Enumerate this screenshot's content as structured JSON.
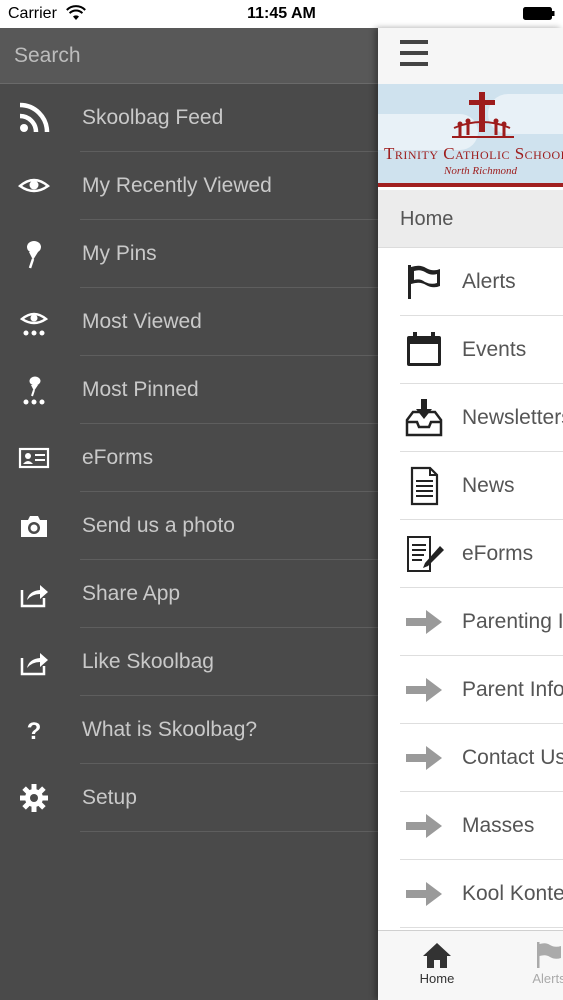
{
  "status_bar": {
    "carrier": "Carrier",
    "time": "11:45 AM"
  },
  "side_menu": {
    "search_placeholder": "Search",
    "items": [
      {
        "label": "Skoolbag Feed",
        "icon": "rss-icon"
      },
      {
        "label": "My Recently Viewed",
        "icon": "eye-icon"
      },
      {
        "label": "My Pins",
        "icon": "pin-icon"
      },
      {
        "label": "Most Viewed",
        "icon": "most-viewed-icon"
      },
      {
        "label": "Most Pinned",
        "icon": "most-pinned-icon"
      },
      {
        "label": "eForms",
        "icon": "id-card-icon"
      },
      {
        "label": "Send us a photo",
        "icon": "camera-icon"
      },
      {
        "label": "Share App",
        "icon": "share-icon"
      },
      {
        "label": "Like Skoolbag",
        "icon": "share-icon"
      },
      {
        "label": "What is Skoolbag?",
        "icon": "question-icon"
      },
      {
        "label": "Setup",
        "icon": "gear-icon"
      }
    ]
  },
  "main": {
    "banner": {
      "school_name": "Trinity Catholic School",
      "school_sub": "North Richmond"
    },
    "section_title": "Home",
    "items": [
      {
        "label": "Alerts",
        "icon": "flag-icon"
      },
      {
        "label": "Events",
        "icon": "calendar-icon"
      },
      {
        "label": "Newsletters",
        "icon": "inbox-download-icon"
      },
      {
        "label": "News",
        "icon": "document-icon"
      },
      {
        "label": "eForms",
        "icon": "form-pen-icon"
      },
      {
        "label": "Parenting Ideas",
        "icon": "arrow-right-icon"
      },
      {
        "label": "Parent Info",
        "icon": "arrow-right-icon"
      },
      {
        "label": "Contact Us",
        "icon": "arrow-right-icon"
      },
      {
        "label": "Masses",
        "icon": "arrow-right-icon"
      },
      {
        "label": "Kool Kontent",
        "icon": "arrow-right-icon"
      }
    ],
    "tabs": [
      {
        "label": "Home",
        "icon": "home-icon"
      },
      {
        "label": "Alerts",
        "icon": "flag-icon"
      }
    ]
  },
  "colors": {
    "menu_bg": "#4a4a4a",
    "menu_text": "#c9c9c9",
    "school_red": "#9d1c1c",
    "arrow_gray": "#9a9a9a"
  }
}
